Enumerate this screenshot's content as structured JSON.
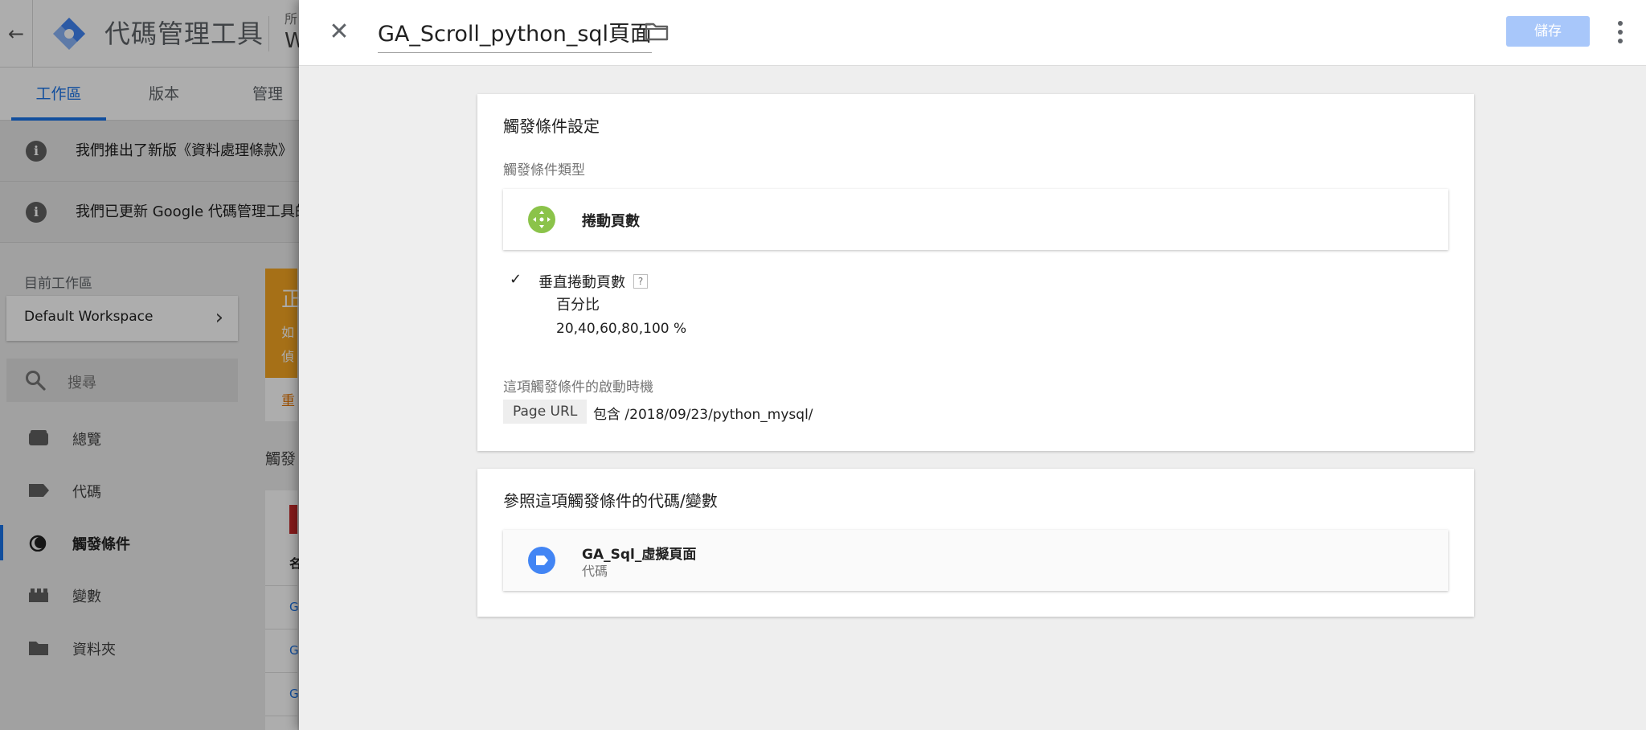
{
  "background_app": {
    "app_title": "代碼管理工具",
    "account_label": "所",
    "account_name": "W",
    "tabs": [
      {
        "label": "工作區"
      },
      {
        "label": "版本"
      },
      {
        "label": "管理"
      }
    ],
    "notices": [
      {
        "text": "我們推出了新版《資料處理條款》"
      },
      {
        "text": "我們已更新 Google 代碼管理工具的"
      }
    ],
    "workspace_label": "目前工作區",
    "workspace_name": "Default Workspace",
    "search_placeholder": "搜尋",
    "nav": [
      {
        "label": "總覽",
        "icon": "overview-icon"
      },
      {
        "label": "代碼",
        "icon": "tag-icon"
      },
      {
        "label": "觸發條件",
        "icon": "trigger-icon"
      },
      {
        "label": "變數",
        "icon": "variable-icon"
      },
      {
        "label": "資料夾",
        "icon": "folder-icon"
      }
    ],
    "orange_card": {
      "title": "正",
      "line1": "如",
      "line2": "偵",
      "action": "重"
    },
    "triggers_heading": "觸發",
    "table_header": "名",
    "table_rows": [
      "G",
      "G",
      "G"
    ]
  },
  "panel": {
    "title": "GA_Scroll_python_sql頁面",
    "save_label": "儲存",
    "config_card": {
      "title": "觸發條件設定",
      "type_label": "觸發條件類型",
      "type_name": "捲動頁數",
      "vertical_scroll_label": "垂直捲動頁數",
      "help_symbol": "?",
      "percent_label": "百分比",
      "percent_values": "20,40,60,80,100 %",
      "fire_on_label": "這項觸發條件的啟動時機",
      "condition_variable": "Page URL",
      "condition_text": "包含 /2018/09/23/python_mysql/"
    },
    "refs_card": {
      "title": "參照這項觸發條件的代碼/變數",
      "item_name": "GA_Sql_虛擬頁面",
      "item_type": "代碼"
    }
  },
  "colors": {
    "accent": "#1a73e8",
    "save_disabled": "#a8c7fa",
    "scroll_icon": "#8bc34a",
    "tag_icon": "#4285f4"
  }
}
